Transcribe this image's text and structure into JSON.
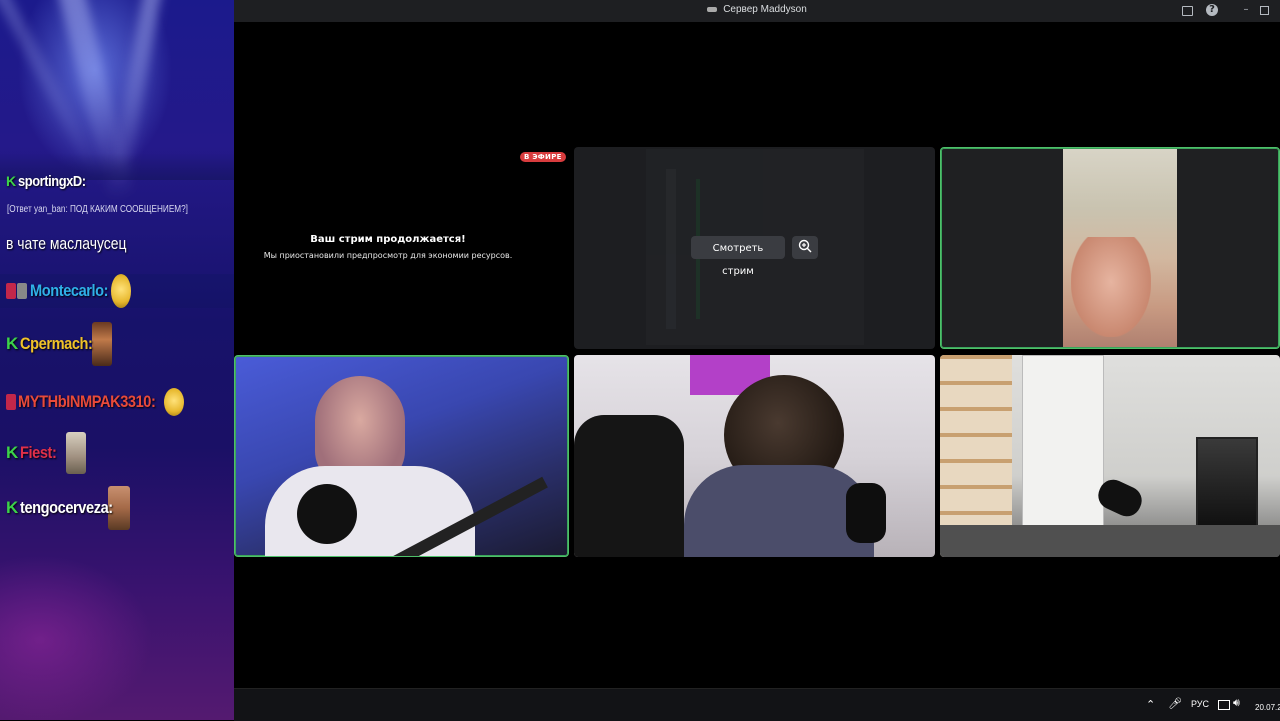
{
  "window": {
    "title": "Сервер Maddyson"
  },
  "chat_overlay": {
    "partial_top_user": "sportingxD:",
    "reply_line": "[Ответ yan_ban: ПОД КАКИМ СООБЩЕНИЕМ?]",
    "message": "в чате маслачусец",
    "entries": [
      {
        "prefix": "",
        "name": "Montecarlo:",
        "color": "#2fb0e8"
      },
      {
        "prefix": "K",
        "name": "Cpermach:",
        "color": "#f0c229"
      },
      {
        "prefix": "",
        "name": "MYTHbINMPAK3310:",
        "color": "#e84a3a"
      },
      {
        "prefix": "K",
        "name": "Fiest:",
        "color": "#e0304a"
      },
      {
        "prefix": "K",
        "name": "tengocerveza:",
        "color": "#ffffff"
      }
    ]
  },
  "stream_paused": {
    "live_badge": "В ЭФИРЕ",
    "title": "Ваш стрим продолжается!",
    "subtitle": "Мы приостановили предпросмотр для экономии ресурсов."
  },
  "stream_preview": {
    "watch_button": "Смотреть стрим"
  },
  "taskbar": {
    "language": "РУС",
    "date": "20.07.2"
  },
  "colors": {
    "active_speaker": "#4fc06a",
    "live_badge": "#d83c3e",
    "titlebar": "#1e1f22"
  }
}
